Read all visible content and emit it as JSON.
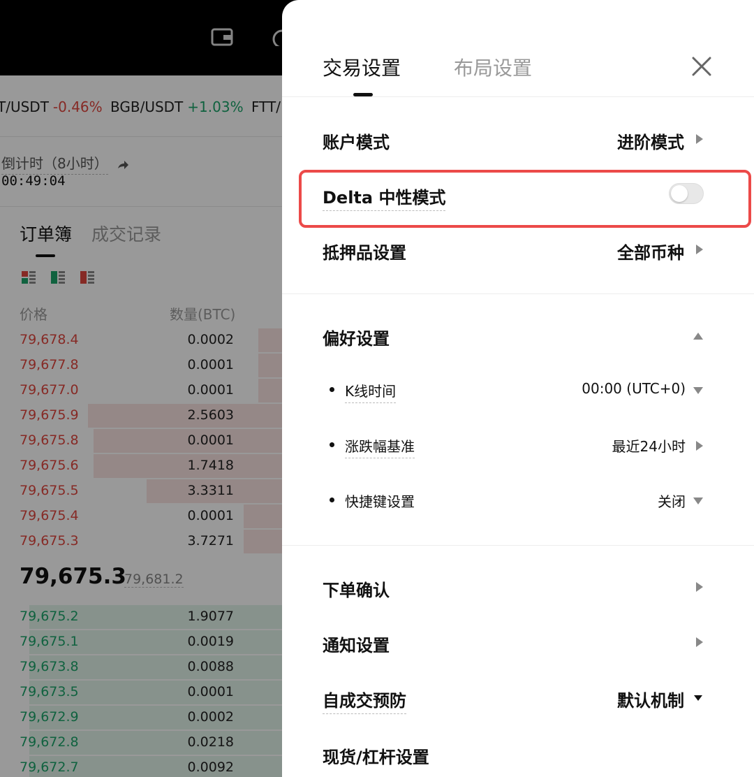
{
  "background": {
    "ticker": [
      {
        "pair": "T/USDT",
        "change": "-0.46%",
        "dir": "down"
      },
      {
        "pair": "BGB/USDT",
        "change": "+1.03%",
        "dir": "up"
      },
      {
        "pair": "FTT/",
        "change": "",
        "dir": "none"
      }
    ],
    "funding_label": "倒计时（8小时）",
    "countdown": "00:49:04",
    "orderbook_tabs": [
      "订单簿",
      "成交记录"
    ],
    "orderbook_headers": {
      "price": "价格",
      "qty": "数量(BTC)"
    },
    "asks": [
      {
        "price": "79,678.4",
        "qty": "0.0002",
        "depth": 0.12
      },
      {
        "price": "79,677.8",
        "qty": "0.0001",
        "depth": 0.12
      },
      {
        "price": "79,677.0",
        "qty": "0.0001",
        "depth": 0.12
      },
      {
        "price": "79,675.9",
        "qty": "2.5603",
        "depth": 0.7
      },
      {
        "price": "79,675.8",
        "qty": "0.0001",
        "depth": 0.68
      },
      {
        "price": "79,675.6",
        "qty": "1.7418",
        "depth": 0.68
      },
      {
        "price": "79,675.5",
        "qty": "3.3311",
        "depth": 0.5
      },
      {
        "price": "79,675.4",
        "qty": "0.0001",
        "depth": 0.17
      },
      {
        "price": "79,675.3",
        "qty": "3.7271",
        "depth": 0.17
      }
    ],
    "mid_price": "79,675.3",
    "mid_index": "79,681.2",
    "bids": [
      {
        "price": "79,675.2",
        "qty": "1.9077",
        "depth": 0.9
      },
      {
        "price": "79,675.1",
        "qty": "0.0019",
        "depth": 0.9
      },
      {
        "price": "79,673.8",
        "qty": "0.0088",
        "depth": 0.9
      },
      {
        "price": "79,673.5",
        "qty": "0.0001",
        "depth": 0.9
      },
      {
        "price": "79,672.9",
        "qty": "0.0002",
        "depth": 0.9
      },
      {
        "price": "79,672.8",
        "qty": "0.0218",
        "depth": 0.9
      },
      {
        "price": "79,672.7",
        "qty": "0.0092",
        "depth": 0.9
      }
    ]
  },
  "drawer": {
    "tabs": {
      "active": "交易设置",
      "inactive": "布局设置"
    },
    "account_mode": {
      "label": "账户模式",
      "value": "进阶模式"
    },
    "delta_neutral": {
      "label": "Delta 中性模式",
      "enabled": false
    },
    "collateral": {
      "label": "抵押品设置",
      "value": "全部币种"
    },
    "preferences": {
      "label": "偏好设置",
      "items": [
        {
          "label": "K线时间",
          "value": "00:00 (UTC+0)",
          "arrow": "down"
        },
        {
          "label": "涨跌幅基准",
          "value": "最近24小时",
          "arrow": "right"
        },
        {
          "label": "快捷键设置",
          "value": "关闭",
          "arrow": "down"
        }
      ]
    },
    "order_confirm": {
      "label": "下单确认"
    },
    "notifications": {
      "label": "通知设置"
    },
    "self_trade": {
      "label": "自成交预防",
      "value": "默认机制"
    },
    "spot_margin": {
      "label": "现货/杠杆设置"
    }
  },
  "colors": {
    "highlight": "#ec4a49",
    "ask": "#e0463f",
    "bid": "#1ca36a"
  }
}
